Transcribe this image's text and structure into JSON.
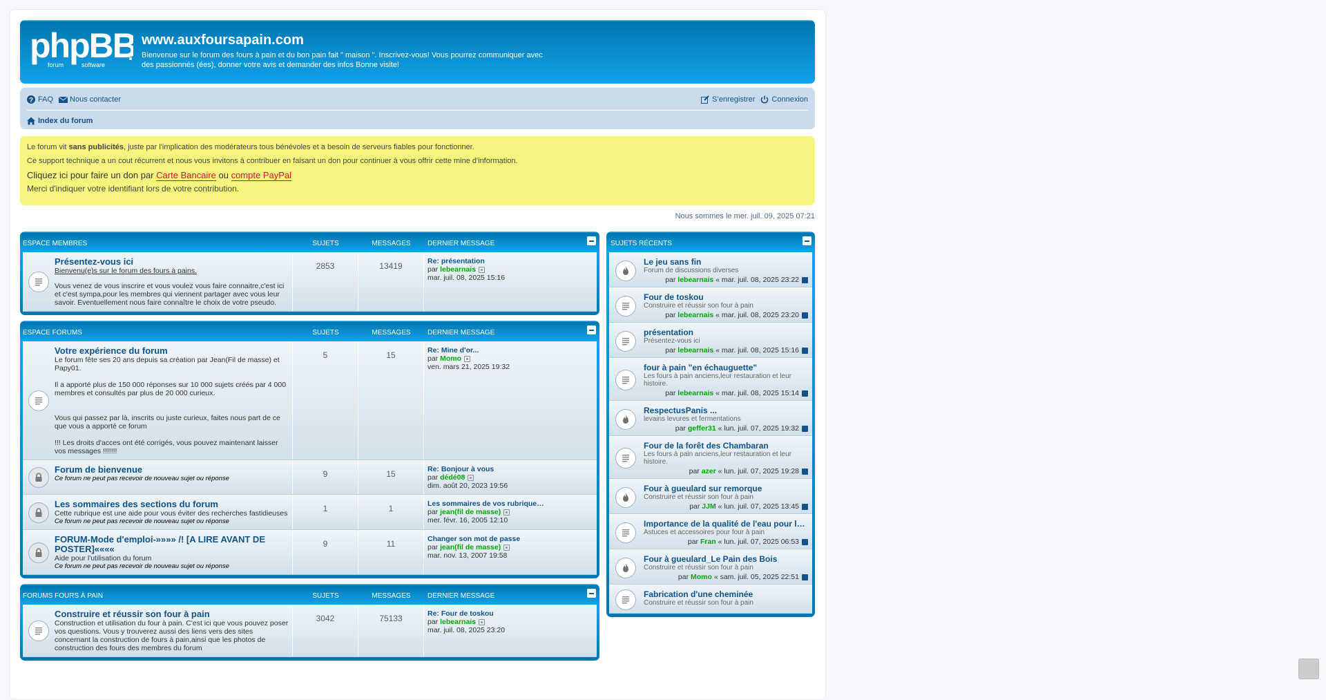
{
  "header": {
    "logo_text": "phpBB forum software",
    "site_title": "www.auxfoursapain.com",
    "site_description": "Bienvenue sur le forum des fours à pain et du bon pain fait \" maison \". Inscrivez-vous! Vous pourrez communiquer avec des passionnés (ées), donner votre avis et demander des infos Bonne visite!"
  },
  "nav": {
    "faq": "FAQ",
    "contact": "Nous contacter",
    "register": "S’enregistrer",
    "login": "Connexion",
    "index": "Index du forum"
  },
  "notice": {
    "line1_pre": "Le forum vit ",
    "line1_bold": "sans publicités",
    "line1_post": ", juste par l'implication des modérateurs tous bénévoles et a besoin de serveurs fiables pour fonctionner.",
    "line2": "Ce support technique a un cout récurrent et nous vous invitons à contribuer en faisant un don pour continuer à vous offrir cette mine d'information.",
    "line3_pre": "Cliquez ici pour faire un don par ",
    "link_card": "Carte Bancaire",
    "line3_mid": " ou ",
    "link_paypal": "compte PayPal",
    "line4": "Merci d'indiquer votre identifiant lors de votre contribution."
  },
  "date_text": "Nous sommes le mer. juil. 09, 2025 07:21",
  "cols": {
    "topics": "SUJETS",
    "posts": "MESSAGES",
    "last": "DERNIER MESSAGE",
    "by": "par"
  },
  "sections": [
    {
      "title": "ESPACE MEMBRES",
      "forums": [
        {
          "name": "Présentez-vous ici",
          "subtitle": "Bienvenu(e)s sur le forum des fours à pains.",
          "desc": "Vous venez de vous inscrire et vous voulez vous faire connaitre,c'est ici et c'est sympa,pour les membres qui viennent partager avec vous leur savoir. Eventuellement nous faire connaître le choix de votre pseudo.",
          "locked": "",
          "topics": "2853",
          "posts": "13419",
          "last_title": "Re: présentation",
          "last_user": "lebearnais",
          "last_date": "mar. juil. 08, 2025 15:16"
        }
      ]
    },
    {
      "title": "ESPACE FORUMS",
      "forums": [
        {
          "name": "Votre expérience du forum",
          "subtitle": "",
          "desc": "Le forum fête ses 20 ans depuis sa création par Jean(Fil de masse) et Papy01.\n\nIl a apporté plus de 150 000 réponses sur 10 000 sujets créés par 4 000 membres et consultés par plus de 20 000 curieux.\n\n\nVous qui passez par là, inscrits ou juste curieux, faites nous part de ce que vous a apporté ce forum\n\n!!! Les droits d'acces ont été corrigés, vous pouvez maintenant laisser vos messages !!!!!!!",
          "locked": "",
          "topics": "5",
          "posts": "15",
          "last_title": "Re: Mine d'or...",
          "last_user": "Momo",
          "last_date": "ven. mars 21, 2025 19:32"
        },
        {
          "name": "Forum de bienvenue",
          "subtitle": "",
          "desc": "",
          "locked": "Ce forum ne peut pas recevoir de nouveau sujet ou réponse",
          "topics": "9",
          "posts": "15",
          "last_title": "Re: Bonjour à vous",
          "last_user": "dédé08",
          "last_date": "dim. août 20, 2023 19:56"
        },
        {
          "name": "Les sommaires des sections du forum",
          "subtitle": "",
          "desc": "Cette rubrique est une aide pour vous éviter des recherches fastidieuses",
          "locked": "Ce forum ne peut pas recevoir de nouveau sujet ou réponse",
          "topics": "1",
          "posts": "1",
          "last_title": "Les sommaires de vos rubrique…",
          "last_user": "jean(fil de masse)",
          "last_date": "mer. févr. 16, 2005 12:10"
        },
        {
          "name": "FORUM-Mode d'emploi-»»»» /! [A LIRE AVANT DE POSTER]««««",
          "subtitle": "",
          "desc": "Aide pour l'utilisation du forum",
          "locked": "Ce forum ne peut pas recevoir de nouveau sujet ou réponse",
          "topics": "9",
          "posts": "11",
          "last_title": "Changer son mot de passe",
          "last_user": "jean(fil de masse)",
          "last_date": "mar. nov. 13, 2007 19:58"
        }
      ]
    },
    {
      "title": "FORUMS FOURS À PAIN",
      "forums": [
        {
          "name": "Construire et réussir son four à pain",
          "subtitle": "",
          "desc": "Construction et utilisation du four à pain. C'est ici que vous pouvez poser vos questions. Vous y trouverez aussi des liens vers des sites concernant la construction de fours à pain,ainsi que les photos de construction des fours des membres du forum",
          "locked": "",
          "topics": "3042",
          "posts": "75133",
          "last_title": "Re: Four de toskou",
          "last_user": "lebearnais",
          "last_date": "mar. juil. 08, 2025 23:20"
        }
      ]
    }
  ],
  "recent": {
    "title": "SUJETS RÉCENTS",
    "items": [
      {
        "title": "Le jeu sans fin",
        "forum": "Forum de discussions diverses",
        "user": "lebearnais",
        "date": "« mar. juil. 08, 2025 23:22",
        "icon": "fire-icon"
      },
      {
        "title": "Four de toskou",
        "forum": "Construire et réussir son four à pain",
        "user": "lebearnais",
        "date": "« mar. juil. 08, 2025 23:20",
        "icon": "topic-icon"
      },
      {
        "title": "présentation",
        "forum": "Présentez-vous ici",
        "user": "lebearnais",
        "date": "« mar. juil. 08, 2025 15:16",
        "icon": "topic-icon"
      },
      {
        "title": "four à pain \"en échauguette\"",
        "forum": "Les fours à pain anciens,leur restauration et leur histoire.",
        "user": "lebearnais",
        "date": "« mar. juil. 08, 2025 15:14",
        "icon": "topic-icon"
      },
      {
        "title": "RespectusPanis ...",
        "forum": "levains levures et fermentations",
        "user": "geffer31",
        "date": "« lun. juil. 07, 2025 19:32",
        "icon": "fire-icon"
      },
      {
        "title": "Four de la forêt des Chambaran",
        "forum": "Les fours à pain anciens,leur restauration et leur histoire.",
        "user": "azer",
        "date": "« lun. juil. 07, 2025 19:28",
        "icon": "topic-icon"
      },
      {
        "title": "Four à gueulard sur remorque",
        "forum": "Construire et réussir son four à pain",
        "user": "JJM",
        "date": "« lun. juil. 07, 2025 13:45",
        "icon": "fire-icon"
      },
      {
        "title": "Importance de la qualité de l'eau pour l…",
        "forum": "Astuces et accessoires pour four à pain",
        "user": "Fran",
        "date": "« lun. juil. 07, 2025 06:53",
        "icon": "topic-icon"
      },
      {
        "title": "Four à gueulard_Le Pain des Bois",
        "forum": "Construire et réussir son four à pain",
        "user": "Momo",
        "date": "« sam. juil. 05, 2025 22:51",
        "icon": "fire-icon"
      },
      {
        "title": "Fabrication d'une cheminée",
        "forum": "Construire et réussir son four à pain",
        "user": "",
        "date": "",
        "icon": "topic-icon"
      }
    ]
  }
}
